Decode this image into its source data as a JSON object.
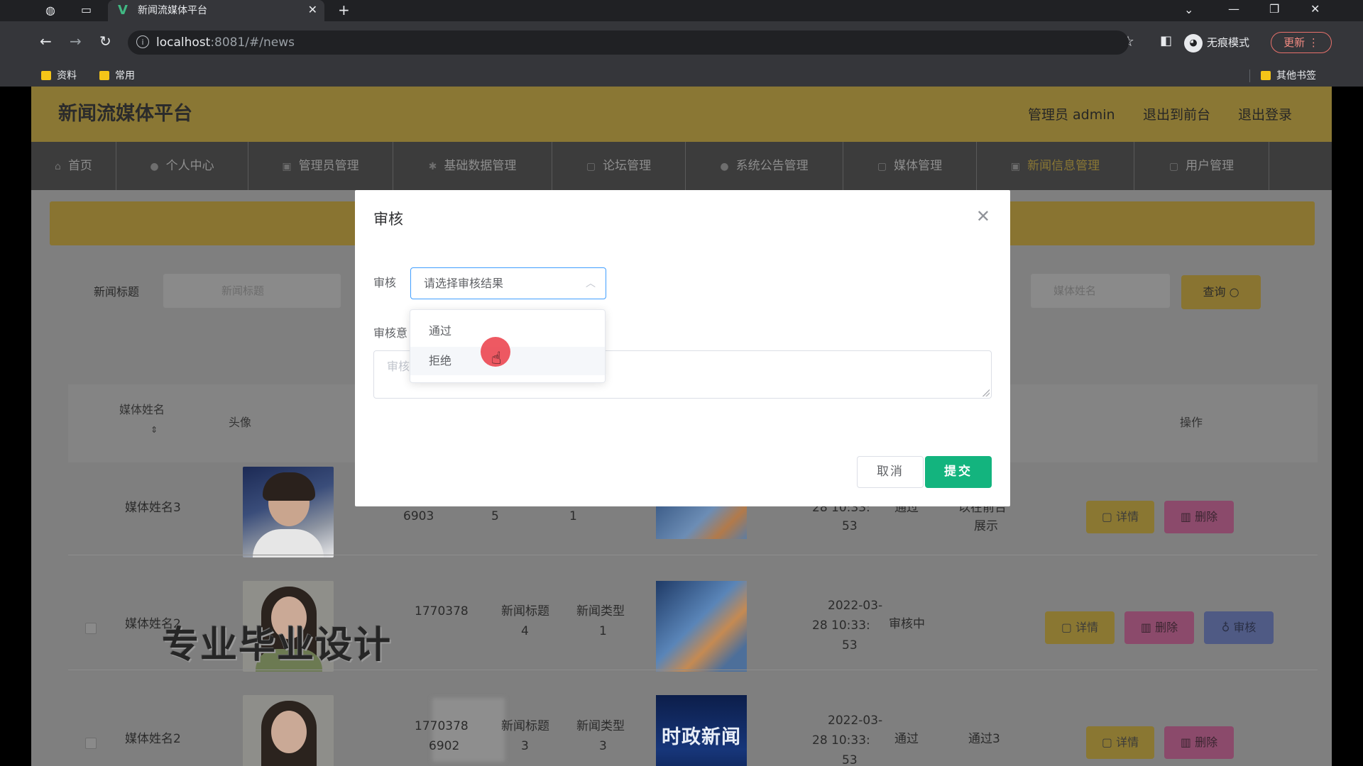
{
  "browser": {
    "tab_title": "新闻流媒体平台",
    "url_host": "localhost",
    "url_path": ":8081/#/news",
    "incognito_label": "无痕模式",
    "update_label": "更新",
    "bookmarks": [
      "资料",
      "常用"
    ],
    "other_bookmarks": "其他书签"
  },
  "header": {
    "title": "新闻流媒体平台",
    "admin": "管理员 admin",
    "back_front": "退出到前台",
    "logout": "退出登录"
  },
  "nav": [
    "首页",
    "个人中心",
    "管理员管理",
    "基础数据管理",
    "论坛管理",
    "系统公告管理",
    "媒体管理",
    "新闻信息管理",
    "用户管理"
  ],
  "search": {
    "title_label": "新闻标题",
    "title_placeholder": "新闻标题",
    "media_placeholder": "媒体姓名",
    "query_label": "查询"
  },
  "table": {
    "headers": {
      "media_name": "媒体姓名",
      "avatar": "头像",
      "operation": "操作"
    },
    "rows": [
      {
        "media": "媒体姓名3",
        "num": "6903",
        "title": "5",
        "type": "1",
        "time": "28 10:33:",
        "time2": "53",
        "status": "通过",
        "reply": "以在前台",
        "reply2": "展示"
      },
      {
        "media": "媒体姓名2",
        "num": "1770378",
        "title": "新闻标题",
        "title2": "4",
        "type": "新闻类型",
        "type2": "1",
        "time": "2022-03-",
        "time2": "28 10:33:",
        "time3": "53",
        "status": "审核中",
        "reply": ""
      },
      {
        "media": "媒体姓名2",
        "num": "1770378",
        "num2": "6902",
        "title": "新闻标题",
        "title2": "3",
        "type": "新闻类型",
        "type2": "3",
        "time": "2022-03-",
        "time2": "28 10:33:",
        "time3": "53",
        "status": "通过",
        "reply": "通过3"
      }
    ],
    "btn_detail": "详情",
    "btn_delete": "删除",
    "btn_audit": "审核",
    "news_image_text": "时政新闻"
  },
  "watermark": "专业毕业设计",
  "dialog": {
    "title": "审核",
    "audit_label": "审核",
    "select_placeholder": "请选择审核结果",
    "opinion_label": "审核意",
    "opinion_placeholder": "审核",
    "options": [
      "通过",
      "拒绝"
    ],
    "cancel": "取消",
    "submit": "提交"
  }
}
